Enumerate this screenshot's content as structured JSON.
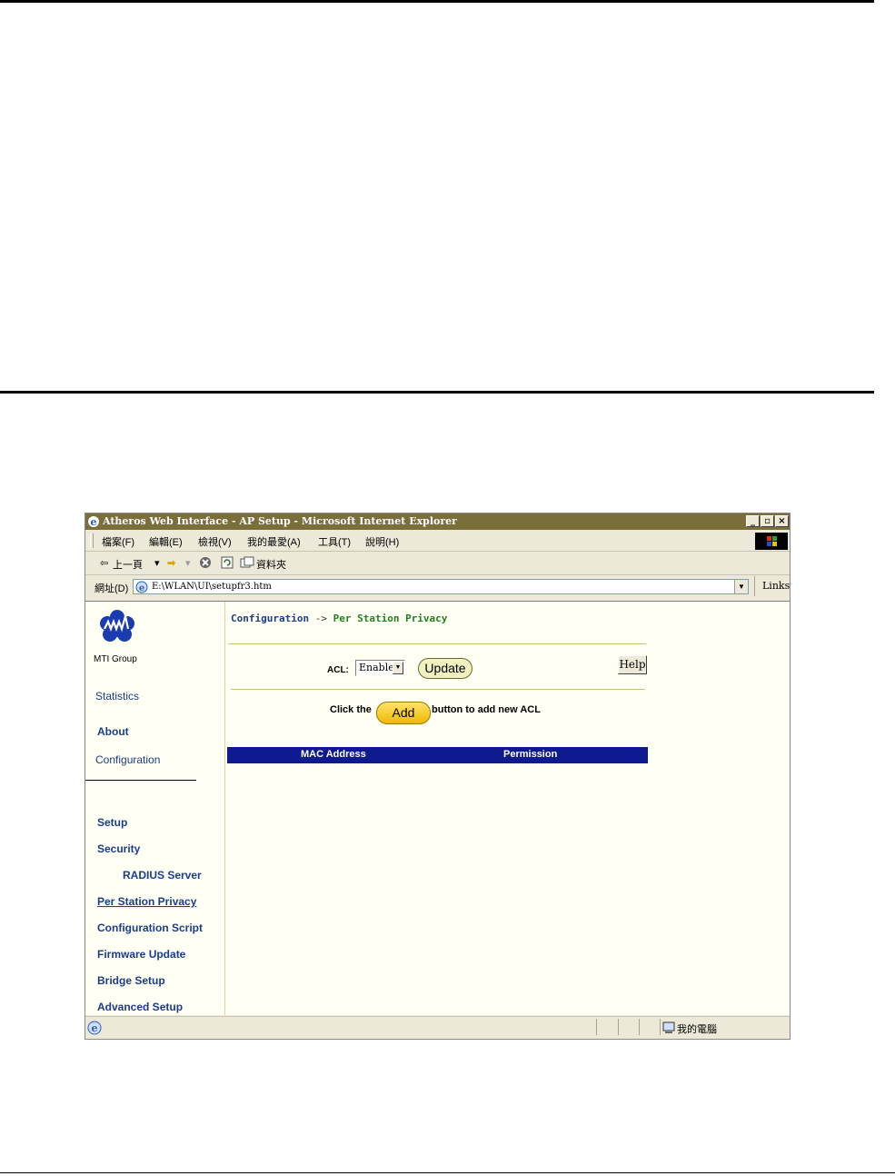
{
  "window": {
    "title": "Atheros Web Interface - AP Setup - Microsoft Internet Explorer",
    "minimize": "_",
    "maximize": "▫",
    "close": "×"
  },
  "menu": {
    "file": "檔案(F)",
    "edit": "編輯(E)",
    "view": "檢視(V)",
    "favorites": "我的最愛(A)",
    "tools": "工具(T)",
    "help": "說明(H)"
  },
  "toolbar": {
    "back": "上一頁",
    "folders": "資料夾"
  },
  "address": {
    "label": "網址(D)",
    "url": "E:\\WLAN\\UI\\setupfr3.htm",
    "links": "Links"
  },
  "sidebar": {
    "brand": "MTI Group",
    "statistics": "Statistics",
    "about": "About",
    "configuration": "Configuration",
    "setup": "Setup",
    "security": "Security",
    "radius": "RADIUS Server",
    "per_station": "Per Station Privacy",
    "config_script": "Configuration Script",
    "firmware": "Firmware Update",
    "bridge": "Bridge Setup",
    "advanced": "Advanced Setup"
  },
  "main": {
    "crumb_root": "Configuration",
    "crumb_sep": "->",
    "crumb_current": "Per Station Privacy",
    "acl_label": "ACL:",
    "acl_value": "Enable",
    "update": "Update",
    "help": "Help",
    "add_prefix": "Click the",
    "add_button": "Add",
    "add_suffix": "button to add new ACL",
    "col_mac": "MAC Address",
    "col_permission": "Permission"
  },
  "status": {
    "zone": "我的電腦"
  },
  "colors": {
    "title_bar": "#7a6e3a",
    "nav_link": "#1a3c8c",
    "table_header": "#0e1a8e",
    "add_button": "#f0c020"
  }
}
